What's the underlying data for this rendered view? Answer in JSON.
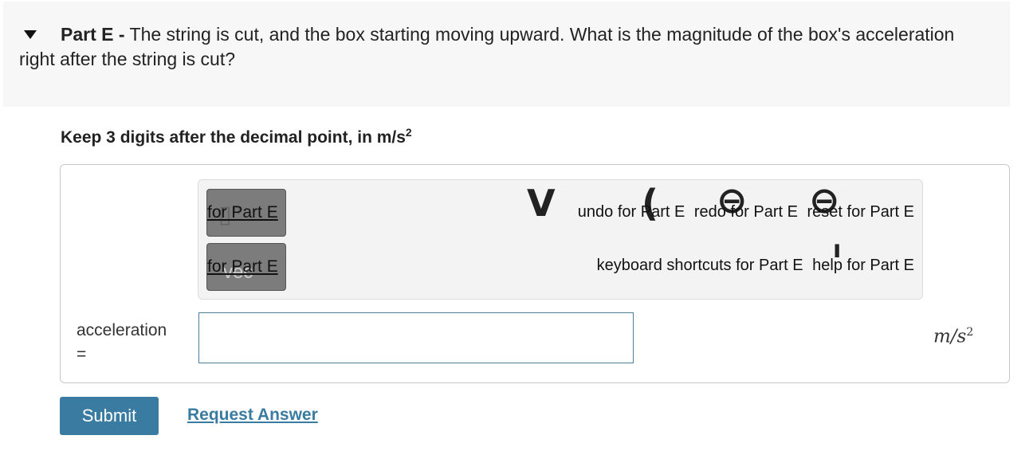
{
  "question": {
    "part_label": "Part E -",
    "text": "The string is cut, and the box starting moving upward. What is the magnitude of the box's acceleration right after the string is cut?"
  },
  "instruction": {
    "text": "Keep 3 digits after the decimal point, in m/s",
    "superscript": "2"
  },
  "toolbar": {
    "button1_label": "for Part E",
    "button2_label": "for Part E",
    "button2_glyph": "vec",
    "undo": "undo for Part E",
    "redo": "redo for Part E",
    "reset": "reset for Part E",
    "keyboard_shortcuts": "keyboard shortcuts for Part E",
    "help": "help for Part E"
  },
  "answer": {
    "label_line1": "acceleration",
    "label_line2": "=",
    "value": "",
    "unit": "m/s",
    "unit_exp": "2"
  },
  "actions": {
    "submit": "Submit",
    "request_answer": "Request Answer"
  }
}
